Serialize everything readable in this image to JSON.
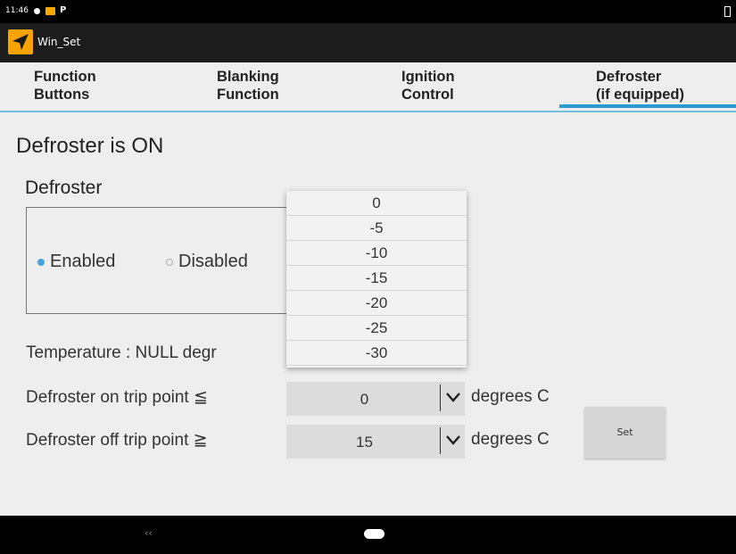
{
  "status_bar": {
    "time": "11:46",
    "extra": "P"
  },
  "app": {
    "title": "Win_Set"
  },
  "tabs": [
    {
      "label": "Function\nButtons"
    },
    {
      "label": "Blanking\nFunction"
    },
    {
      "label": "Ignition\nControl"
    },
    {
      "label": "Defroster\n(if equipped)"
    }
  ],
  "active_tab": "Defroster (if equipped)",
  "main": {
    "status_heading": "Defroster is ON",
    "section_title": "Defroster",
    "radio_enabled": "Enabled",
    "radio_disabled": "Disabled",
    "selected_radio": "Enabled",
    "temperature_label": "Temperature :  NULL  degr",
    "on_trip_label": "Defroster on trip point ≦",
    "on_trip_value": "0",
    "on_trip_units": "degrees C",
    "off_trip_label": "Defroster off trip point ≧",
    "off_trip_value": "15",
    "off_trip_units": "degrees C",
    "set_button": "Set"
  },
  "dropdown": {
    "options": [
      "0",
      "-5",
      "-10",
      "-15",
      "-20",
      "-25",
      "-30"
    ]
  },
  "nav": {
    "back": "‹‹"
  },
  "colors": {
    "accent": "#2a9ad0",
    "tab_underline": "#74c0dc",
    "app_icon": "#f8a300",
    "radio_on": "#4aa3d8"
  }
}
